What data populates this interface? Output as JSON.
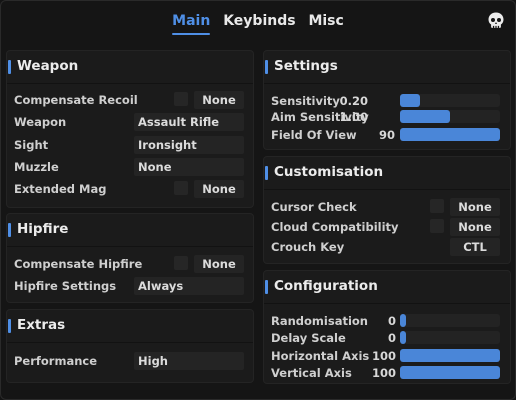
{
  "tabs": [
    {
      "label": "Main",
      "active": true
    },
    {
      "label": "Keybinds",
      "active": false
    },
    {
      "label": "Misc",
      "active": false
    }
  ],
  "accent_color": "#4f8fe6",
  "weapon": {
    "title": "Weapon",
    "compensate_recoil": {
      "label": "Compensate Recoil",
      "key": "None"
    },
    "weapon": {
      "label": "Weapon",
      "value": "Assault Rifle"
    },
    "sight": {
      "label": "Sight",
      "value": "Ironsight"
    },
    "muzzle": {
      "label": "Muzzle",
      "value": "None"
    },
    "extended_mag": {
      "label": "Extended Mag",
      "key": "None"
    }
  },
  "hipfire": {
    "title": "Hipfire",
    "compensate_hipfire": {
      "label": "Compensate Hipfire",
      "key": "None"
    },
    "hipfire_settings": {
      "label": "Hipfire Settings",
      "value": "Always"
    }
  },
  "extras": {
    "title": "Extras",
    "performance": {
      "label": "Performance",
      "value": "High"
    }
  },
  "settings": {
    "title": "Settings",
    "sensitivity": {
      "label": "Sensitivity",
      "value": "0.20",
      "fill": 0.2
    },
    "aim_sensitivity": {
      "label": "Aim Sensitivity",
      "value": "1.00",
      "fill": 0.5
    },
    "fov": {
      "label": "Field Of View",
      "value": "90",
      "fill": 1.0
    }
  },
  "customisation": {
    "title": "Customisation",
    "cursor_check": {
      "label": "Cursor Check",
      "key": "None"
    },
    "cloud_compat": {
      "label": "Cloud Compatibility",
      "key": "None"
    },
    "crouch_key": {
      "label": "Crouch Key",
      "key": "CTL"
    }
  },
  "configuration": {
    "title": "Configuration",
    "randomisation": {
      "label": "Randomisation",
      "value": "0",
      "fill": 0.0
    },
    "delay_scale": {
      "label": "Delay Scale",
      "value": "0",
      "fill": 0.0
    },
    "horizontal_axis": {
      "label": "Horizontal Axis",
      "value": "100",
      "fill": 1.0
    },
    "vertical_axis": {
      "label": "Vertical Axis",
      "value": "100",
      "fill": 1.0
    }
  }
}
